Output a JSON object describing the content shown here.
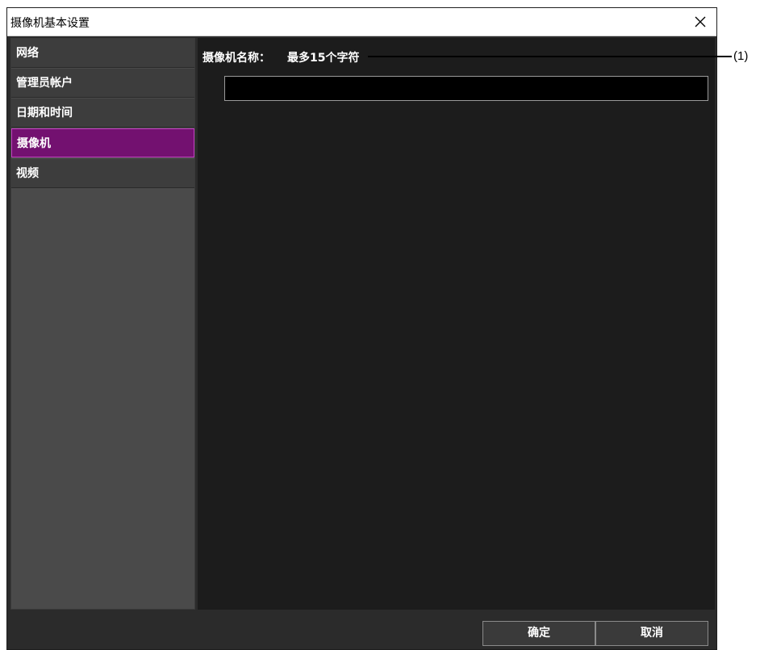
{
  "window": {
    "title": "摄像机基本设置",
    "close_icon": "close-icon"
  },
  "sidebar": {
    "items": [
      {
        "label": "网络",
        "active": false
      },
      {
        "label": "管理员帐户",
        "active": false
      },
      {
        "label": "日期和时间",
        "active": false
      },
      {
        "label": "摄像机",
        "active": true
      },
      {
        "label": "视频",
        "active": false
      }
    ],
    "active_color": "#731170"
  },
  "content": {
    "camera_name_label": "摄像机名称：",
    "camera_name_hint": "最多15个字符",
    "camera_name_value": ""
  },
  "footer": {
    "ok_label": "确定",
    "cancel_label": "取消"
  },
  "annotation": {
    "label": "(1)"
  }
}
